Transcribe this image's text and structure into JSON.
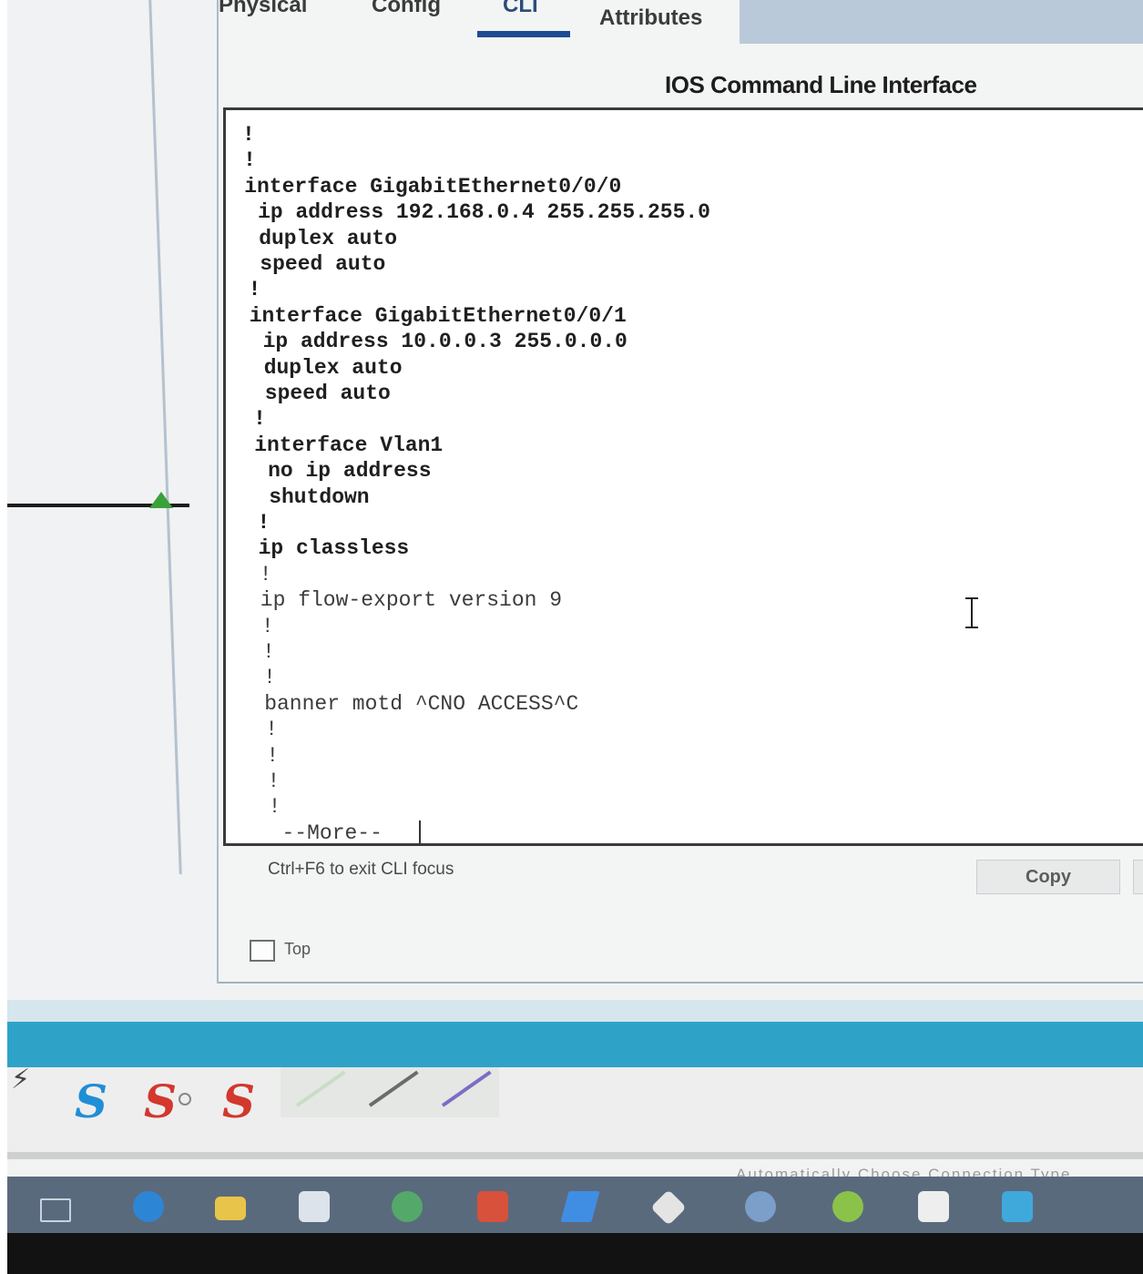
{
  "tabs": {
    "physical": "Physical",
    "config": "Config",
    "cli": "CLI",
    "attributes": "Attributes"
  },
  "cli_title": "IOS Command Line Interface",
  "terminal": {
    "lines": [
      "!",
      "!",
      "interface GigabitEthernet0/0/0",
      " ip address 192.168.0.4 255.255.255.0",
      " duplex auto",
      " speed auto",
      "!",
      "interface GigabitEthernet0/0/1",
      " ip address 10.0.0.3 255.0.0.0",
      " duplex auto",
      " speed auto",
      "!",
      "interface Vlan1",
      " no ip address",
      " shutdown",
      "!",
      "ip classless",
      "!",
      "ip flow-export version 9",
      "!",
      "!",
      "!",
      "banner motd ^CNO ACCESS^C",
      "!",
      "!",
      "!",
      "!",
      " --More-- "
    ]
  },
  "hint": "Ctrl+F6 to exit CLI focus",
  "buttons": {
    "copy": "Copy"
  },
  "top_checkbox": {
    "label": "Top",
    "checked": false
  },
  "connections": {
    "auto_label": "Automatically Choose Connection Type",
    "auto_symbol": "⚡"
  },
  "colors": {
    "tab_active": "#1e4c92",
    "toolbar_teal": "#2fa3c7",
    "link_indicator": "#3aa13a"
  }
}
